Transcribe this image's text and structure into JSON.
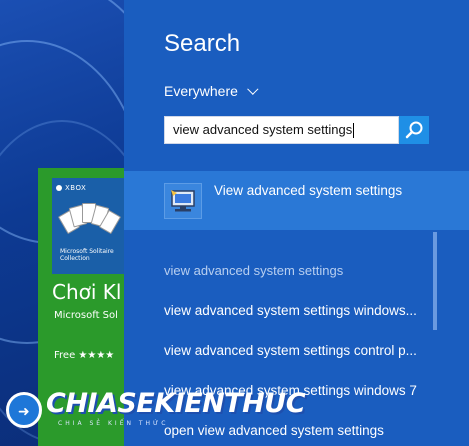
{
  "panel": {
    "title": "Search",
    "scope_label": "Everywhere",
    "query": "view advanced system settings",
    "best_match": "View advanced system settings",
    "suggestions": [
      "view advanced system settings",
      "view advanced system settings windows...",
      "view advanced system settings control p...",
      "view advanced system settings windows 7",
      "open view advanced system settings"
    ]
  },
  "tile": {
    "xbox": "XBOX",
    "caption": "Microsoft Solitaire Collection",
    "name": "Chơi Kl",
    "publisher": "Microsoft Sol",
    "rating": "Free ★★★★"
  },
  "watermark": {
    "text": "CHIASEKIENTHUC",
    "sub": "CHIA SẺ KIẾN THỨC"
  },
  "colors": {
    "panel_bg": "#1a5dbf",
    "best_match_bg": "#2a78d6",
    "search_button": "#1f8fe6",
    "tile_green": "#2b9a2b"
  }
}
